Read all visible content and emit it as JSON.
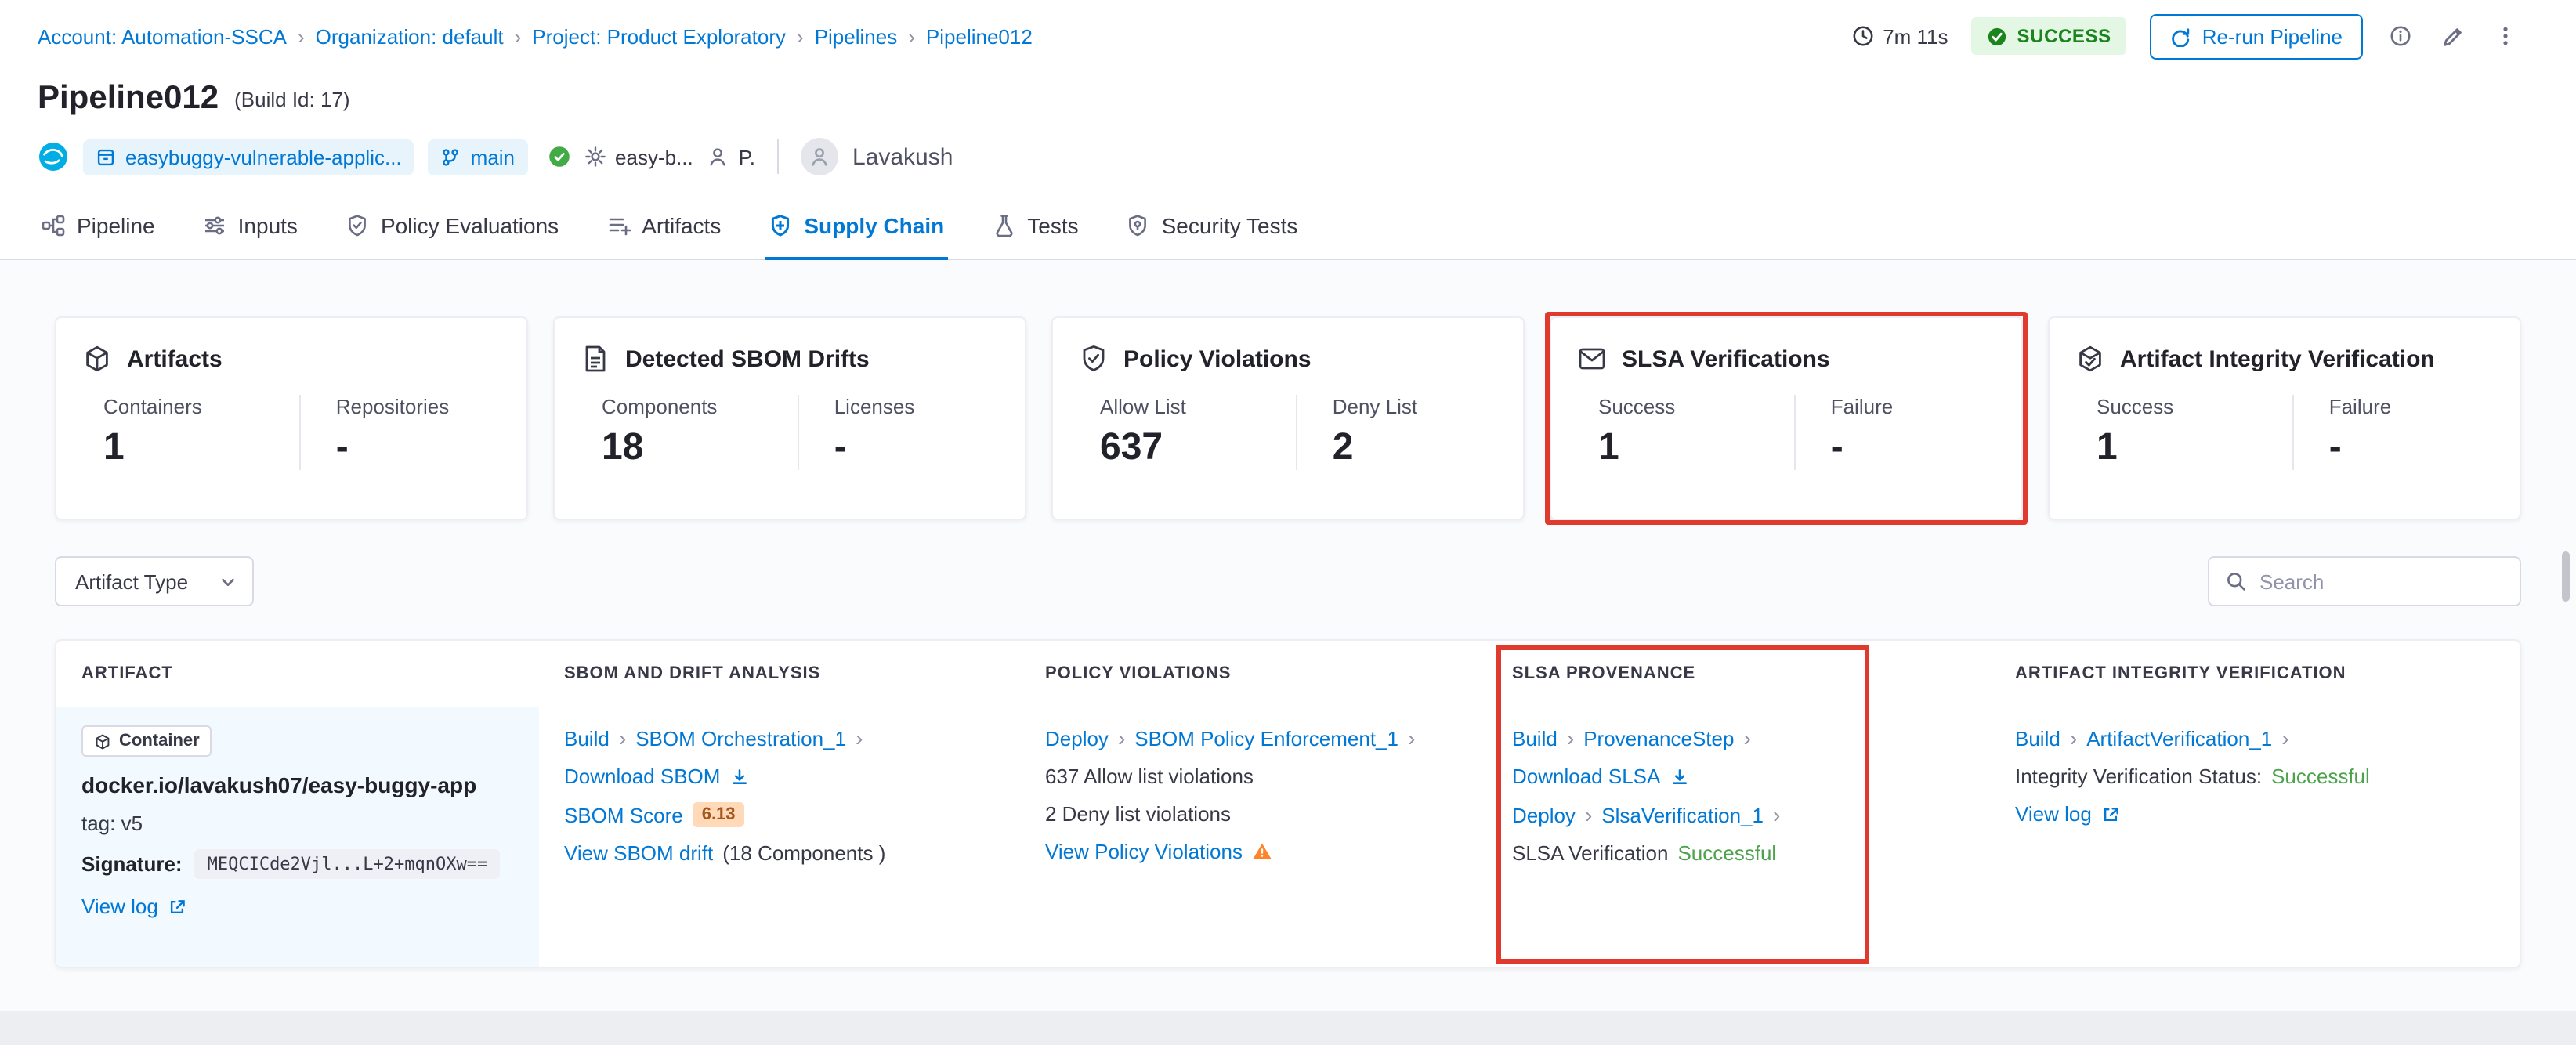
{
  "colors": {
    "accent_blue": "#0278D5",
    "success_green": "#1B841D",
    "status_green_text": "#4DA24D",
    "annotation_red": "#E0392E",
    "warning_orange": "#FF832B",
    "score_badge_bg": "#FFD9B8"
  },
  "breadcrumb": {
    "items": [
      {
        "label": "Account: Automation-SSCA"
      },
      {
        "label": "Organization: default"
      },
      {
        "label": "Project: Product Exploratory"
      },
      {
        "label": "Pipelines"
      },
      {
        "label": "Pipeline012"
      }
    ]
  },
  "header": {
    "duration": "7m 11s",
    "status": "SUCCESS",
    "rerun_label": "Re-run Pipeline",
    "title": "Pipeline012",
    "build_id": "(Build Id: 17)"
  },
  "meta": {
    "repo": "easybuggy-vulnerable-applic...",
    "branch": "main",
    "service": "easy-b...",
    "person": "P.",
    "user": "Lavakush"
  },
  "tabs": [
    {
      "label": "Pipeline"
    },
    {
      "label": "Inputs"
    },
    {
      "label": "Policy Evaluations"
    },
    {
      "label": "Artifacts"
    },
    {
      "label": "Supply Chain"
    },
    {
      "label": "Tests"
    },
    {
      "label": "Security Tests"
    }
  ],
  "cards": [
    {
      "title": "Artifacts",
      "stats": [
        {
          "label": "Containers",
          "value": "1"
        },
        {
          "label": "Repositories",
          "value": "-"
        }
      ]
    },
    {
      "title": "Detected SBOM Drifts",
      "stats": [
        {
          "label": "Components",
          "value": "18"
        },
        {
          "label": "Licenses",
          "value": "-"
        }
      ]
    },
    {
      "title": "Policy Violations",
      "stats": [
        {
          "label": "Allow List",
          "value": "637"
        },
        {
          "label": "Deny List",
          "value": "2"
        }
      ]
    },
    {
      "title": "SLSA Verifications",
      "stats": [
        {
          "label": "Success",
          "value": "1"
        },
        {
          "label": "Failure",
          "value": "-"
        }
      ]
    },
    {
      "title": "Artifact Integrity Verification",
      "stats": [
        {
          "label": "Success",
          "value": "1"
        },
        {
          "label": "Failure",
          "value": "-"
        }
      ]
    }
  ],
  "filters": {
    "artifact_type_label": "Artifact Type",
    "search_placeholder": "Search"
  },
  "table": {
    "headers": [
      "ARTIFACT",
      "SBOM AND DRIFT ANALYSIS",
      "POLICY VIOLATIONS",
      "SLSA PROVENANCE",
      "ARTIFACT INTEGRITY VERIFICATION"
    ],
    "row": {
      "artifact": {
        "type": "Container",
        "name": "docker.io/lavakush07/easy-buggy-app",
        "tag": "tag: v5",
        "signature_label": "Signature:",
        "signature": "MEQCICde2Vjl...L+2+mqnOXw==",
        "view_log": "View log"
      },
      "sbom": {
        "stage": "Build",
        "step": "SBOM Orchestration_1",
        "download": "Download SBOM",
        "score_label": "SBOM Score",
        "score": "6.13",
        "drift_link": "View SBOM drift",
        "drift_meta": "(18 Components )"
      },
      "policy": {
        "stage": "Deploy",
        "step": "SBOM Policy Enforcement_1",
        "allow_text": "637 Allow list violations",
        "deny_text": "2 Deny list violations",
        "view_link": "View Policy Violations"
      },
      "slsa": {
        "stage1": "Build",
        "step1": "ProvenanceStep",
        "download": "Download SLSA",
        "stage2": "Deploy",
        "step2": "SlsaVerification_1",
        "status_prefix": "SLSA Verification",
        "status": "Successful"
      },
      "integrity": {
        "stage": "Build",
        "step": "ArtifactVerification_1",
        "status_prefix": "Integrity Verification Status:",
        "status": "Successful",
        "view_log": "View log"
      }
    }
  }
}
